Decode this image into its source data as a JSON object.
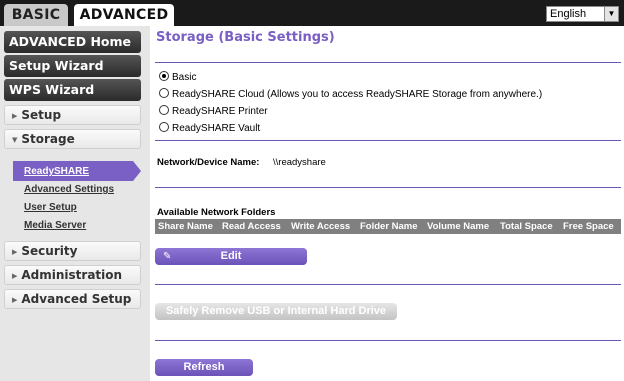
{
  "tabs": {
    "basic": "BASIC",
    "advanced": "ADVANCED"
  },
  "language": {
    "selected": "English",
    "arrow": "▼"
  },
  "sidebar": {
    "advanced_home": "ADVANCED Home",
    "setup_wizard": "Setup Wizard",
    "wps_wizard": "WPS Wizard",
    "setup": "Setup",
    "storage": "Storage",
    "storage_items": [
      "ReadySHARE",
      "Advanced Settings",
      "User Setup",
      "Media Server"
    ],
    "security": "Security",
    "administration": "Administration",
    "advanced_setup": "Advanced Setup",
    "caret_collapsed": "▶",
    "caret_expanded": "▼"
  },
  "main": {
    "title": "Storage (Basic Settings)",
    "options": [
      {
        "label": "Basic",
        "checked": true
      },
      {
        "label": "ReadySHARE Cloud (Allows you to access ReadySHARE Storage from anywhere.)",
        "checked": false
      },
      {
        "label": "ReadySHARE Printer",
        "checked": false
      },
      {
        "label": "ReadySHARE Vault",
        "checked": false
      }
    ],
    "network_device_label": "Network/Device Name:",
    "network_device_value": "\\\\readyshare",
    "folders_title": "Available Network Folders",
    "columns": [
      "Share Name",
      "Read Access",
      "Write Access",
      "Folder Name",
      "Volume Name",
      "Total Space",
      "Free Space"
    ],
    "edit_label": "Edit",
    "safely_remove_label": "Safely Remove USB or Internal Hard Drive",
    "refresh_label": "Refresh"
  },
  "colors": {
    "accent": "#7a5fc4",
    "topbar": "#1a1a1a",
    "sidebar_bg": "#e6e6e6"
  }
}
